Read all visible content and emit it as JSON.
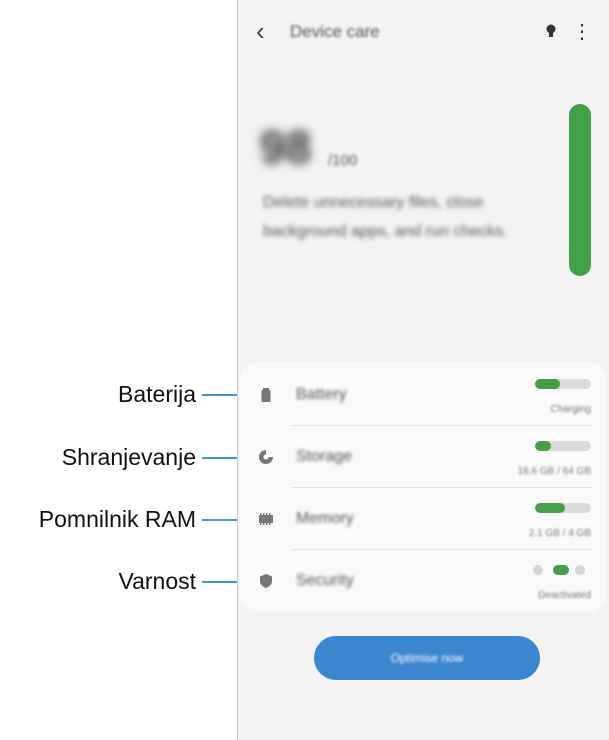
{
  "callouts": [
    {
      "label": "Baterija"
    },
    {
      "label": "Shranjevanje"
    },
    {
      "label": "Pomnilnik RAM"
    },
    {
      "label": "Varnost"
    }
  ],
  "header": {
    "title": "Device care"
  },
  "score": {
    "value": "98",
    "unit": "/100",
    "message": "Delete unnecessary files, close background apps, and run checks."
  },
  "status_bar_level": 0.98,
  "items": [
    {
      "name": "Battery",
      "status": "Charging",
      "level": 0.45,
      "icon": "battery-icon"
    },
    {
      "name": "Storage",
      "status": "18.6 GB / 64 GB",
      "level": 0.29,
      "icon": "storage-icon"
    },
    {
      "name": "Memory",
      "status": "2.1 GB / 4 GB",
      "level": 0.53,
      "icon": "memory-icon"
    },
    {
      "name": "Security",
      "status": "Deactivated",
      "icon": "shield-icon"
    }
  ],
  "optimize": {
    "label": "Optimise now"
  },
  "colors": {
    "accent_green": "#43a047",
    "button_blue": "#3b86cf",
    "callout_line": "#3a9bc9"
  }
}
